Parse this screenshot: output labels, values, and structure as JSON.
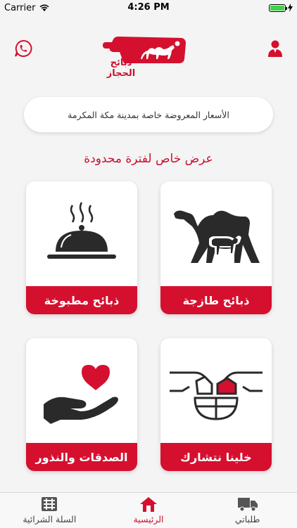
{
  "status_bar": {
    "carrier": "Carrier",
    "time": "4:26 PM"
  },
  "header": {
    "logo_text": "ذبائح الحجاز"
  },
  "notice": {
    "text": "الأسعار المعروضة خاصة بمدينة مكة المكرمة"
  },
  "promo": {
    "text": "عرض خاص لفترة محدودة"
  },
  "cards": [
    {
      "label": "ذبائح طازجة",
      "icon": "camel-sheep-icon"
    },
    {
      "label": "ذبائح مطبوخة",
      "icon": "serving-dish-icon"
    },
    {
      "label": "خلينا نتشارك",
      "icon": "sharing-hands-icon"
    },
    {
      "label": "الصدقات والنذور",
      "icon": "heart-hand-icon"
    }
  ],
  "tabbar": {
    "tabs": [
      {
        "label": "السلة الشرائية",
        "icon": "shopping-basket-icon"
      },
      {
        "label": "الرئيسية",
        "icon": "home-icon",
        "active": true
      },
      {
        "label": "طلباتي",
        "icon": "delivery-truck-icon"
      }
    ]
  },
  "colors": {
    "accent": "#d5102f",
    "background": "#f4f4f4"
  }
}
